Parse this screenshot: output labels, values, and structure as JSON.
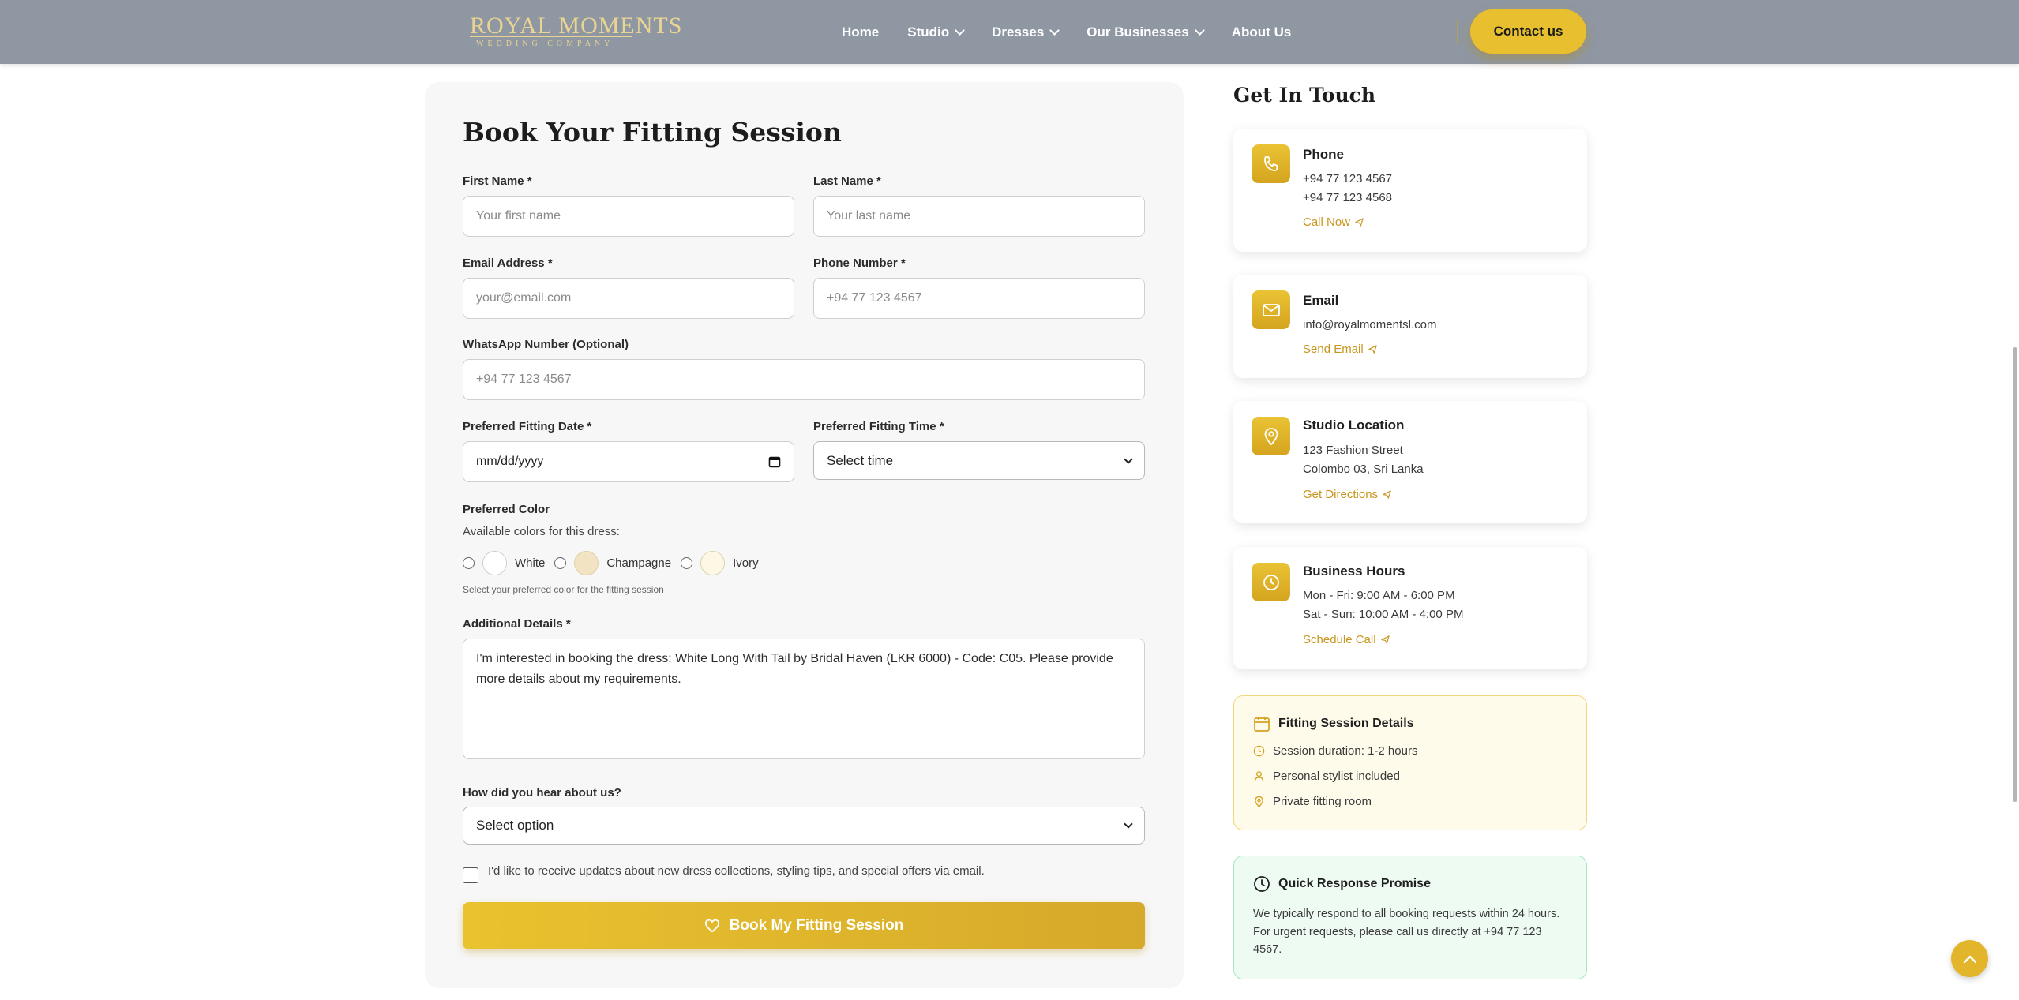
{
  "header": {
    "logo_main": "ROYAL MOMENTS",
    "logo_sub": "WEDDING COMPANY",
    "nav": [
      "Home",
      "Studio",
      "Dresses",
      "Our Businesses",
      "About Us"
    ],
    "contact_label": "Contact us"
  },
  "form": {
    "title": "Book Your Fitting Session",
    "first_name_label": "First Name *",
    "first_name_placeholder": "Your first name",
    "last_name_label": "Last Name *",
    "last_name_placeholder": "Your last name",
    "email_label": "Email Address *",
    "email_placeholder": "your@email.com",
    "phone_label": "Phone Number *",
    "phone_placeholder": "+94 77 123 4567",
    "whatsapp_label": "WhatsApp Number (Optional)",
    "whatsapp_placeholder": "+94 77 123 4567",
    "date_label": "Preferred Fitting Date *",
    "date_value": "mm/dd/yyyy",
    "time_label": "Preferred Fitting Time *",
    "time_value": "Select time",
    "color_label": "Preferred Color",
    "color_sub": "Available colors for this dress:",
    "colors": [
      {
        "name": "White",
        "hex": "#ffffff"
      },
      {
        "name": "Champagne",
        "hex": "#f2e3c3"
      },
      {
        "name": "Ivory",
        "hex": "#fdf8e6"
      }
    ],
    "color_hint": "Select your preferred color for the fitting session",
    "details_label": "Additional Details *",
    "details_value": "I'm interested in booking the dress: White Long With Tail by Bridal Haven (LKR 6000) - Code: C05. Please provide more details about my requirements.",
    "hear_label": "How did you hear about us?",
    "hear_value": "Select option",
    "newsletter_text": "I'd like to receive updates about new dress collections, styling tips, and special offers via email.",
    "submit_label": "Book My Fitting Session"
  },
  "side": {
    "title": "Get In Touch",
    "phone": {
      "title": "Phone",
      "line1": "+94 77 123 4567",
      "line2": "+94 77 123 4568",
      "link": "Call Now"
    },
    "email": {
      "title": "Email",
      "line1": "info@royalmomentsl.com",
      "link": "Send Email"
    },
    "location": {
      "title": "Studio Location",
      "line1": "123 Fashion Street",
      "line2": "Colombo 03, Sri Lanka",
      "link": "Get Directions"
    },
    "hours": {
      "title": "Business Hours",
      "line1": "Mon - Fri: 9:00 AM - 6:00 PM",
      "line2": "Sat - Sun: 10:00 AM - 4:00 PM",
      "link": "Schedule Call"
    },
    "fitting": {
      "title": "Fitting Session Details",
      "items": [
        "Session duration: 1-2 hours",
        "Personal stylist included",
        "Private fitting room"
      ]
    },
    "promise": {
      "title": "Quick Response Promise",
      "text": "We typically respond to all booking requests within 24 hours. For urgent requests, please call us directly at +94 77 123 4567."
    }
  },
  "colors": {
    "accent": "#e8bf2e",
    "accent_dark": "#c9961d",
    "header_bg": "#8f97a3"
  }
}
